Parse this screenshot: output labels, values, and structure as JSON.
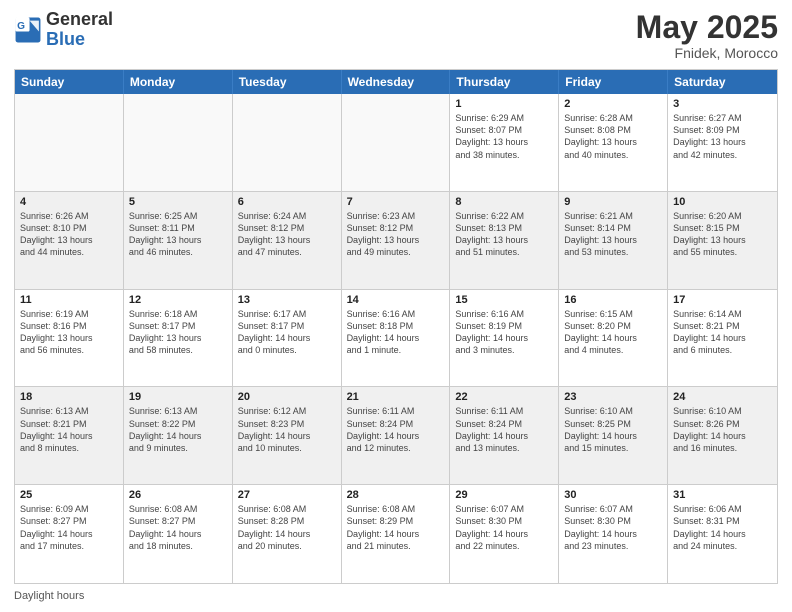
{
  "logo": {
    "text_general": "General",
    "text_blue": "Blue"
  },
  "header": {
    "month_year": "May 2025",
    "location": "Fnidek, Morocco"
  },
  "weekdays": [
    "Sunday",
    "Monday",
    "Tuesday",
    "Wednesday",
    "Thursday",
    "Friday",
    "Saturday"
  ],
  "footer": {
    "label": "Daylight hours"
  },
  "weeks": [
    [
      {
        "day": "",
        "info": ""
      },
      {
        "day": "",
        "info": ""
      },
      {
        "day": "",
        "info": ""
      },
      {
        "day": "",
        "info": ""
      },
      {
        "day": "1",
        "info": "Sunrise: 6:29 AM\nSunset: 8:07 PM\nDaylight: 13 hours\nand 38 minutes."
      },
      {
        "day": "2",
        "info": "Sunrise: 6:28 AM\nSunset: 8:08 PM\nDaylight: 13 hours\nand 40 minutes."
      },
      {
        "day": "3",
        "info": "Sunrise: 6:27 AM\nSunset: 8:09 PM\nDaylight: 13 hours\nand 42 minutes."
      }
    ],
    [
      {
        "day": "4",
        "info": "Sunrise: 6:26 AM\nSunset: 8:10 PM\nDaylight: 13 hours\nand 44 minutes."
      },
      {
        "day": "5",
        "info": "Sunrise: 6:25 AM\nSunset: 8:11 PM\nDaylight: 13 hours\nand 46 minutes."
      },
      {
        "day": "6",
        "info": "Sunrise: 6:24 AM\nSunset: 8:12 PM\nDaylight: 13 hours\nand 47 minutes."
      },
      {
        "day": "7",
        "info": "Sunrise: 6:23 AM\nSunset: 8:12 PM\nDaylight: 13 hours\nand 49 minutes."
      },
      {
        "day": "8",
        "info": "Sunrise: 6:22 AM\nSunset: 8:13 PM\nDaylight: 13 hours\nand 51 minutes."
      },
      {
        "day": "9",
        "info": "Sunrise: 6:21 AM\nSunset: 8:14 PM\nDaylight: 13 hours\nand 53 minutes."
      },
      {
        "day": "10",
        "info": "Sunrise: 6:20 AM\nSunset: 8:15 PM\nDaylight: 13 hours\nand 55 minutes."
      }
    ],
    [
      {
        "day": "11",
        "info": "Sunrise: 6:19 AM\nSunset: 8:16 PM\nDaylight: 13 hours\nand 56 minutes."
      },
      {
        "day": "12",
        "info": "Sunrise: 6:18 AM\nSunset: 8:17 PM\nDaylight: 13 hours\nand 58 minutes."
      },
      {
        "day": "13",
        "info": "Sunrise: 6:17 AM\nSunset: 8:17 PM\nDaylight: 14 hours\nand 0 minutes."
      },
      {
        "day": "14",
        "info": "Sunrise: 6:16 AM\nSunset: 8:18 PM\nDaylight: 14 hours\nand 1 minute."
      },
      {
        "day": "15",
        "info": "Sunrise: 6:16 AM\nSunset: 8:19 PM\nDaylight: 14 hours\nand 3 minutes."
      },
      {
        "day": "16",
        "info": "Sunrise: 6:15 AM\nSunset: 8:20 PM\nDaylight: 14 hours\nand 4 minutes."
      },
      {
        "day": "17",
        "info": "Sunrise: 6:14 AM\nSunset: 8:21 PM\nDaylight: 14 hours\nand 6 minutes."
      }
    ],
    [
      {
        "day": "18",
        "info": "Sunrise: 6:13 AM\nSunset: 8:21 PM\nDaylight: 14 hours\nand 8 minutes."
      },
      {
        "day": "19",
        "info": "Sunrise: 6:13 AM\nSunset: 8:22 PM\nDaylight: 14 hours\nand 9 minutes."
      },
      {
        "day": "20",
        "info": "Sunrise: 6:12 AM\nSunset: 8:23 PM\nDaylight: 14 hours\nand 10 minutes."
      },
      {
        "day": "21",
        "info": "Sunrise: 6:11 AM\nSunset: 8:24 PM\nDaylight: 14 hours\nand 12 minutes."
      },
      {
        "day": "22",
        "info": "Sunrise: 6:11 AM\nSunset: 8:24 PM\nDaylight: 14 hours\nand 13 minutes."
      },
      {
        "day": "23",
        "info": "Sunrise: 6:10 AM\nSunset: 8:25 PM\nDaylight: 14 hours\nand 15 minutes."
      },
      {
        "day": "24",
        "info": "Sunrise: 6:10 AM\nSunset: 8:26 PM\nDaylight: 14 hours\nand 16 minutes."
      }
    ],
    [
      {
        "day": "25",
        "info": "Sunrise: 6:09 AM\nSunset: 8:27 PM\nDaylight: 14 hours\nand 17 minutes."
      },
      {
        "day": "26",
        "info": "Sunrise: 6:08 AM\nSunset: 8:27 PM\nDaylight: 14 hours\nand 18 minutes."
      },
      {
        "day": "27",
        "info": "Sunrise: 6:08 AM\nSunset: 8:28 PM\nDaylight: 14 hours\nand 20 minutes."
      },
      {
        "day": "28",
        "info": "Sunrise: 6:08 AM\nSunset: 8:29 PM\nDaylight: 14 hours\nand 21 minutes."
      },
      {
        "day": "29",
        "info": "Sunrise: 6:07 AM\nSunset: 8:30 PM\nDaylight: 14 hours\nand 22 minutes."
      },
      {
        "day": "30",
        "info": "Sunrise: 6:07 AM\nSunset: 8:30 PM\nDaylight: 14 hours\nand 23 minutes."
      },
      {
        "day": "31",
        "info": "Sunrise: 6:06 AM\nSunset: 8:31 PM\nDaylight: 14 hours\nand 24 minutes."
      }
    ]
  ]
}
